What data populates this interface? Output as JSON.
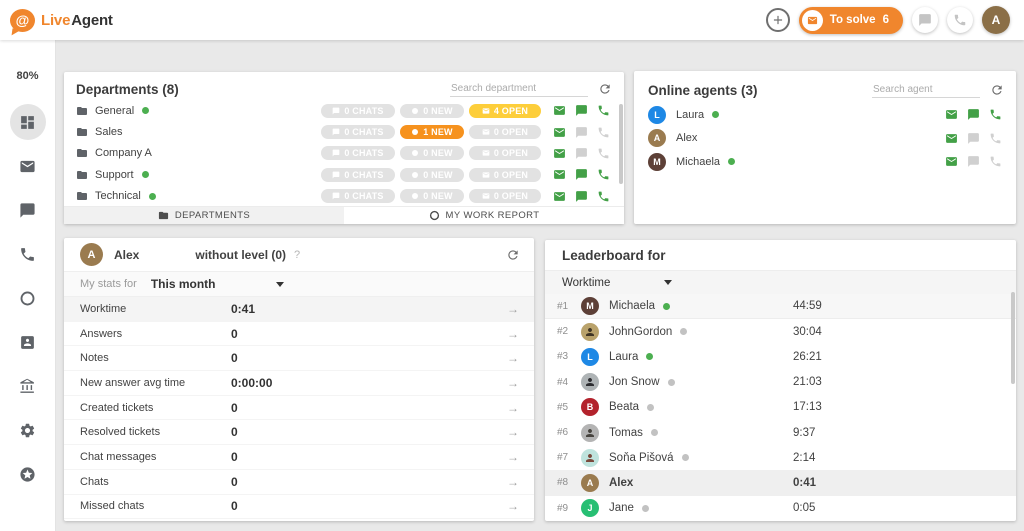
{
  "topbar": {
    "logo_live": "Live",
    "logo_agent": "Agent",
    "logo_at": "@",
    "to_solve_label": "To solve",
    "to_solve_count": "6",
    "avatar_initial": "A",
    "brand_orange": "#F0862D"
  },
  "sidebar": {
    "availability": "80%",
    "icons": [
      "dashboard",
      "mail",
      "chat",
      "phone",
      "history",
      "contacts",
      "bank",
      "settings",
      "star"
    ],
    "active_icon": "dashboard"
  },
  "departments": {
    "title": "Departments (8)",
    "search_placeholder": "Search department",
    "rows": [
      {
        "name": "General",
        "online": true,
        "chats": "0 CHATS",
        "new": "0 NEW",
        "new_alert": false,
        "open": "4 OPEN",
        "open_warn": true,
        "chat_active": true,
        "phone_active": true
      },
      {
        "name": "Sales",
        "online": false,
        "chats": "0 CHATS",
        "new": "1 NEW",
        "new_alert": true,
        "open": "0 OPEN",
        "open_warn": false,
        "chat_active": false,
        "phone_active": false
      },
      {
        "name": "Company A",
        "online": false,
        "chats": "0 CHATS",
        "new": "0 NEW",
        "new_alert": false,
        "open": "0 OPEN",
        "open_warn": false,
        "chat_active": false,
        "phone_active": false
      },
      {
        "name": "Support",
        "online": true,
        "chats": "0 CHATS",
        "new": "0 NEW",
        "new_alert": false,
        "open": "0 OPEN",
        "open_warn": false,
        "chat_active": true,
        "phone_active": true
      },
      {
        "name": "Technical",
        "online": true,
        "chats": "0 CHATS",
        "new": "0 NEW",
        "new_alert": false,
        "open": "0 OPEN",
        "open_warn": false,
        "chat_active": true,
        "phone_active": true
      }
    ],
    "tabs": [
      {
        "label": "DEPARTMENTS",
        "icon": "folder",
        "active": true
      },
      {
        "label": "MY WORK REPORT",
        "icon": "ring",
        "active": false
      }
    ]
  },
  "agents": {
    "title": "Online agents (3)",
    "search_placeholder": "Search agent",
    "rows": [
      {
        "name": "Laura",
        "initial": "L",
        "color": "#1E88E5",
        "online": true,
        "chat_active": true,
        "phone_active": true
      },
      {
        "name": "Alex",
        "initial": "A",
        "color": "#9A7B4F",
        "online": false,
        "chat_active": false,
        "phone_active": false
      },
      {
        "name": "Michaela",
        "initial": "M",
        "color": "#5D4037",
        "online": true,
        "chat_active": false,
        "phone_active": false
      }
    ]
  },
  "stats": {
    "agent_name": "Alex",
    "agent_initial": "A",
    "agent_color": "#9A7B4F",
    "level_label": "without level (0)",
    "help": "?",
    "filter_label": "My stats for",
    "filter_value": "This month",
    "rows": [
      {
        "label": "Worktime",
        "value": "0:41",
        "highlight": true
      },
      {
        "label": "Answers",
        "value": "0",
        "highlight": false
      },
      {
        "label": "Notes",
        "value": "0",
        "highlight": false
      },
      {
        "label": "New answer avg time",
        "value": "0:00:00",
        "highlight": false
      },
      {
        "label": "Created tickets",
        "value": "0",
        "highlight": false
      },
      {
        "label": "Resolved tickets",
        "value": "0",
        "highlight": false
      },
      {
        "label": "Chat messages",
        "value": "0",
        "highlight": false
      },
      {
        "label": "Chats",
        "value": "0",
        "highlight": false
      },
      {
        "label": "Missed chats",
        "value": "0",
        "highlight": false
      }
    ]
  },
  "leaderboard": {
    "title": "Leaderboard for",
    "metric": "Worktime",
    "rows": [
      {
        "rank": "#1",
        "name": "Michaela",
        "value": "44:59",
        "avatar_kind": "initial",
        "initial": "M",
        "color": "#5D4037",
        "dot": "green",
        "highlight": "hl1",
        "bold": false
      },
      {
        "rank": "#2",
        "name": "JohnGordon",
        "value": "30:04",
        "avatar_kind": "photo",
        "initial": "",
        "color": "#b9a26b",
        "fg": "#3f3424",
        "dot": "gray",
        "highlight": "",
        "bold": false
      },
      {
        "rank": "#3",
        "name": "Laura",
        "value": "26:21",
        "avatar_kind": "initial",
        "initial": "L",
        "color": "#1E88E5",
        "dot": "green",
        "highlight": "",
        "bold": false
      },
      {
        "rank": "#4",
        "name": "Jon Snow",
        "value": "21:03",
        "avatar_kind": "photo",
        "initial": "",
        "color": "#aeb3b5",
        "fg": "#2c2c30",
        "dot": "gray",
        "highlight": "",
        "bold": false
      },
      {
        "rank": "#5",
        "name": "Beata",
        "value": "17:13",
        "avatar_kind": "initial",
        "initial": "B",
        "color": "#B3222C",
        "dot": "gray",
        "highlight": "",
        "bold": false
      },
      {
        "rank": "#6",
        "name": "Tomas",
        "value": "9:37",
        "avatar_kind": "photo",
        "initial": "",
        "color": "#b4b4b4",
        "fg": "#46433e",
        "dot": "gray",
        "highlight": "",
        "bold": false
      },
      {
        "rank": "#7",
        "name": "Soňa Pišová",
        "value": "2:14",
        "avatar_kind": "photo",
        "initial": "",
        "color": "#bfe3dd",
        "fg": "#7a4a3c",
        "dot": "gray",
        "highlight": "",
        "bold": false
      },
      {
        "rank": "#8",
        "name": "Alex",
        "value": "0:41",
        "avatar_kind": "initial",
        "initial": "A",
        "color": "#9A7B4F",
        "dot": "",
        "highlight": "hl8",
        "bold": true
      },
      {
        "rank": "#9",
        "name": "Jane",
        "value": "0:05",
        "avatar_kind": "initial",
        "initial": "J",
        "color": "#27BF73",
        "dot": "gray",
        "highlight": "",
        "bold": false
      }
    ]
  }
}
